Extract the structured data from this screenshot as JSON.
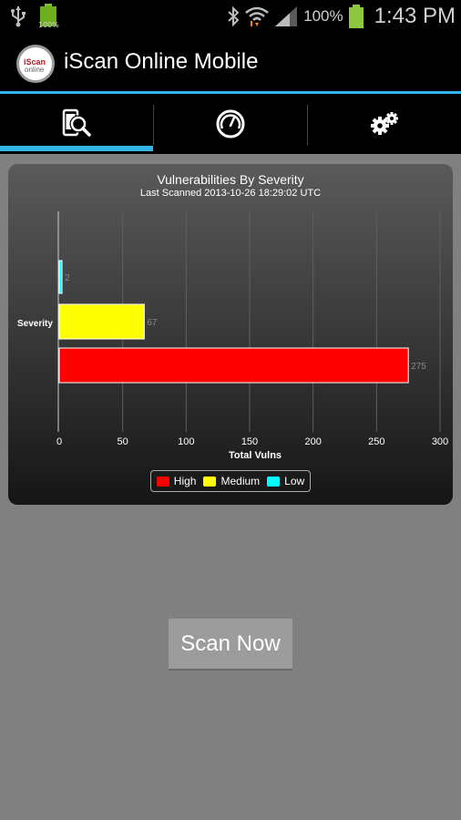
{
  "status_bar": {
    "small_battery_label": "100%",
    "battery_percent": "100%",
    "time": "1:43 PM",
    "icons": [
      "usb-icon",
      "battery-full-icon",
      "bluetooth-icon",
      "wifi-icon",
      "signal-icon",
      "battery-icon"
    ]
  },
  "app": {
    "title": "iScan Online Mobile",
    "logo_line1": "iScan",
    "logo_line2": "online"
  },
  "tabs": [
    {
      "name": "scan",
      "icon": "phone-magnifier-icon",
      "selected": true
    },
    {
      "name": "dashboard",
      "icon": "gauge-icon",
      "selected": false
    },
    {
      "name": "settings",
      "icon": "gears-icon",
      "selected": false
    }
  ],
  "colors": {
    "accent": "#33b5e5",
    "high": "#ff0000",
    "medium": "#ffff00",
    "low": "#00ffff"
  },
  "chart_data": {
    "type": "bar",
    "orientation": "horizontal",
    "title": "Vulnerabilities By Severity",
    "subtitle": "Last Scanned 2013-10-26 18:29:02 UTC",
    "xlabel": "Total Vulns",
    "ylabel": "Severity",
    "xlim": [
      0,
      300
    ],
    "xticks": [
      "0",
      "50",
      "100",
      "150",
      "200",
      "250",
      "300"
    ],
    "grid": true,
    "legend_position": "bottom",
    "series": [
      {
        "name": "High",
        "value": 275,
        "color": "#ff0000"
      },
      {
        "name": "Medium",
        "value": 67,
        "color": "#ffff00"
      },
      {
        "name": "Low",
        "value": 2,
        "color": "#00ffff"
      }
    ]
  },
  "scan_button_label": "Scan Now"
}
